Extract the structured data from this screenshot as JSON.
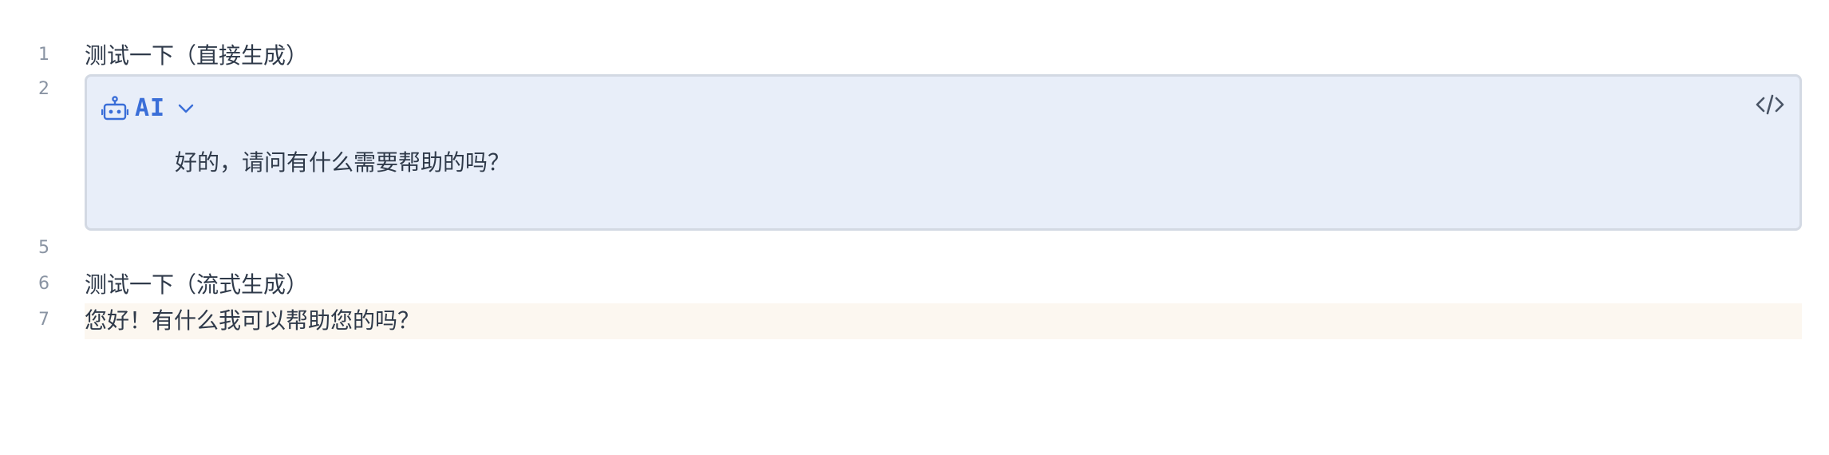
{
  "lines": [
    {
      "number": "1",
      "text": "测试一下（直接生成）"
    },
    {
      "number": "2"
    },
    {
      "number": "5",
      "text": ""
    },
    {
      "number": "6",
      "text": "测试一下（流式生成）"
    },
    {
      "number": "7",
      "text": "您好！有什么我可以帮助您的吗？"
    }
  ],
  "ai_block": {
    "label": "AI",
    "icon": "robot-icon",
    "menu_icon": "chevron-down-icon",
    "view_source_icon": "code-icon",
    "content": "好的，请问有什么需要帮助的吗？",
    "accent_color": "#3a6ed8",
    "background_color": "#e8eef9"
  },
  "highlight_color": "#fcf7f0"
}
